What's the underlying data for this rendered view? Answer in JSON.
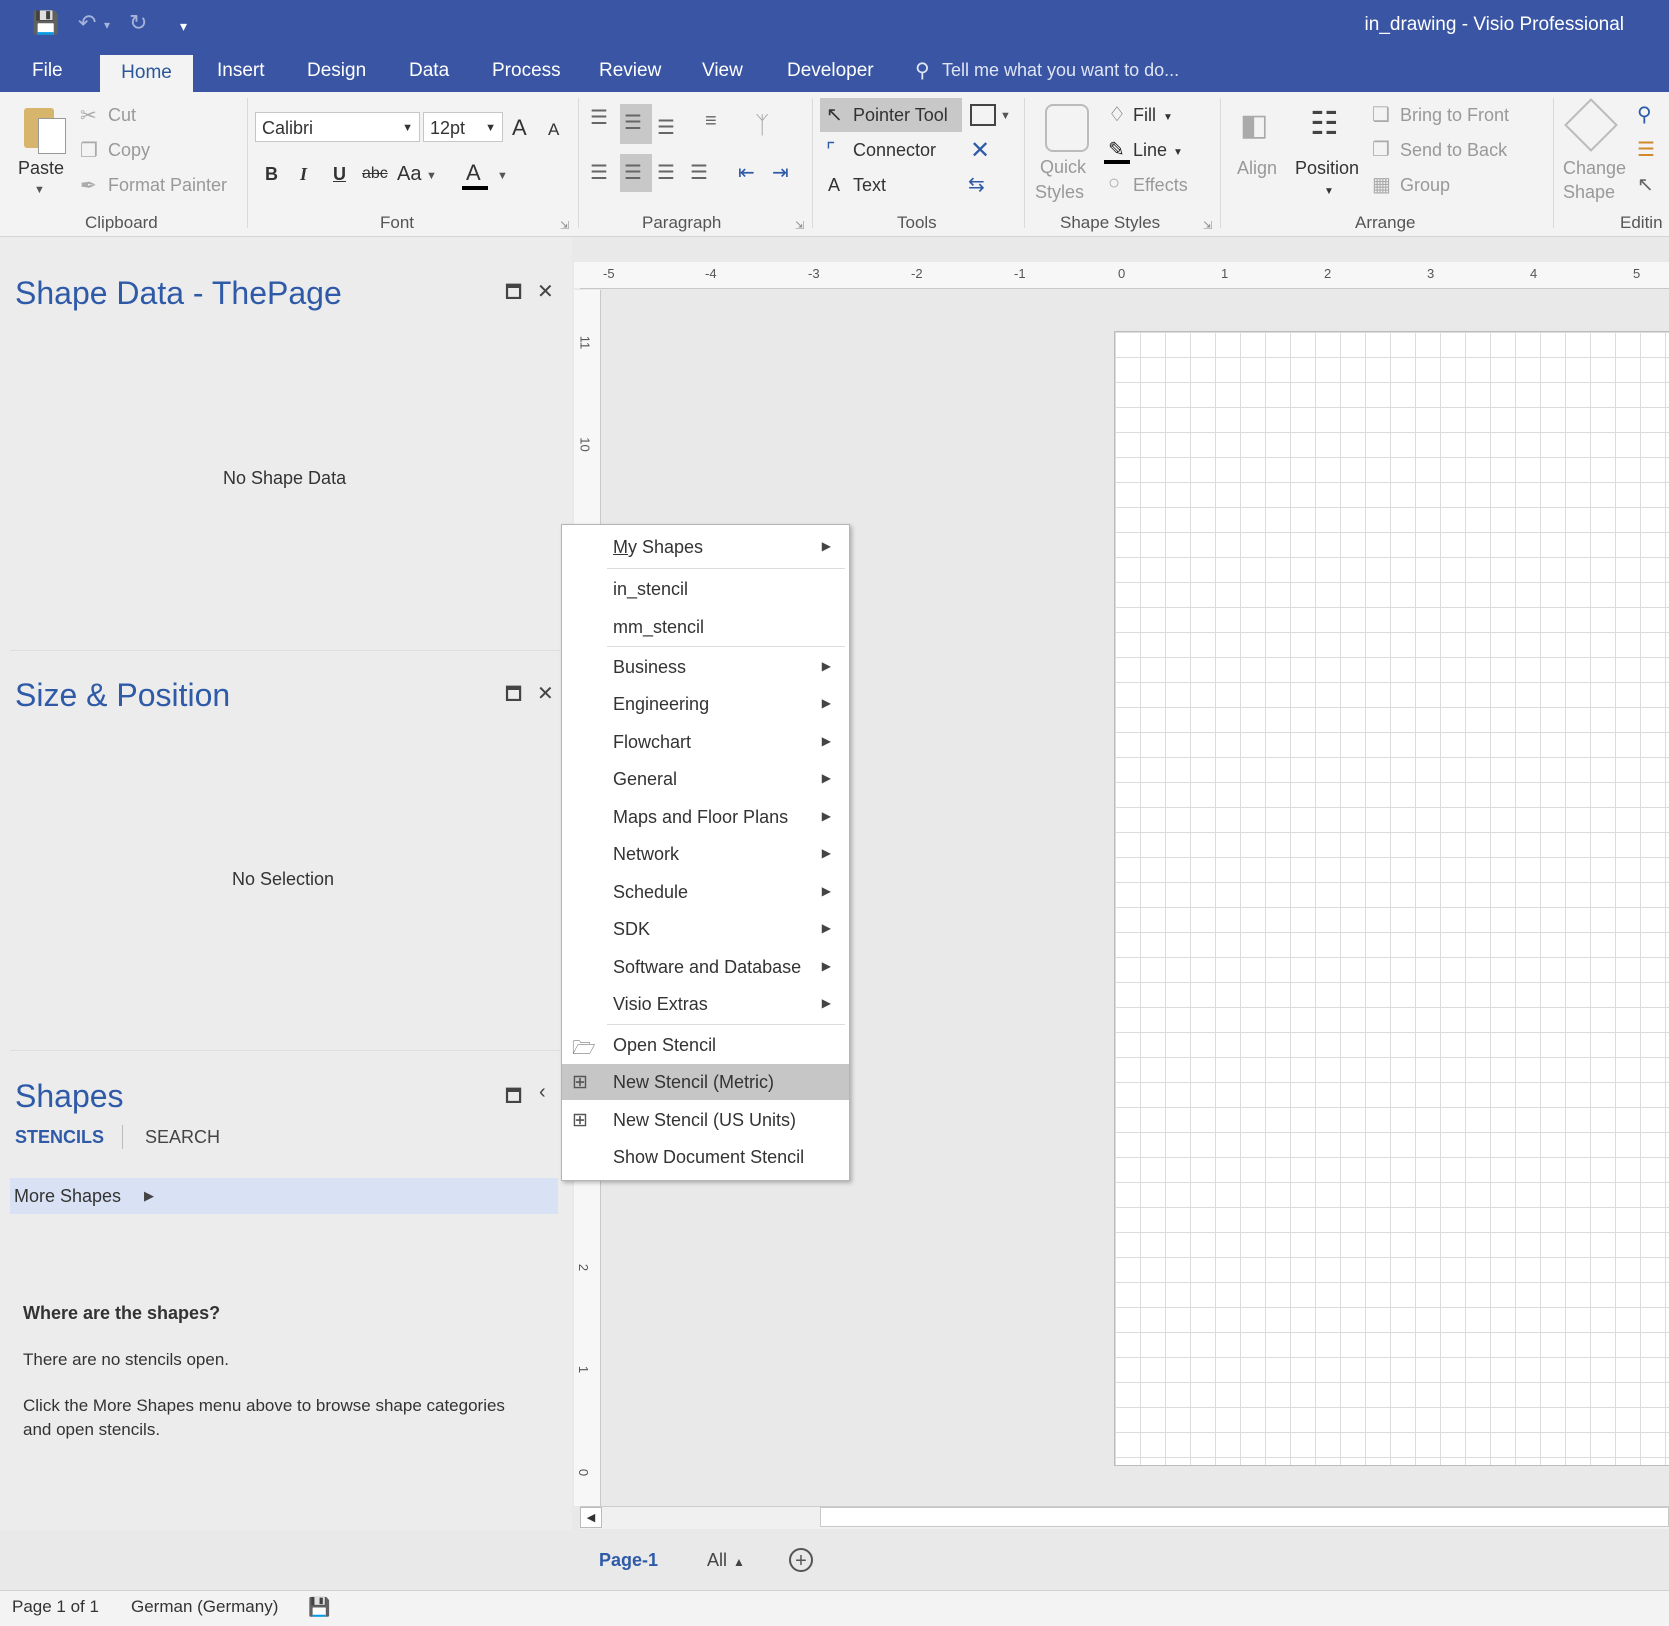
{
  "app": {
    "title": "in_drawing - Visio Professional"
  },
  "tabs": {
    "file": "File",
    "home": "Home",
    "insert": "Insert",
    "design": "Design",
    "data": "Data",
    "process": "Process",
    "review": "Review",
    "view": "View",
    "developer": "Developer"
  },
  "tellme": "Tell me what you want to do...",
  "clipboard": {
    "paste": "Paste",
    "cut": "Cut",
    "copy": "Copy",
    "format_painter": "Format Painter",
    "label": "Clipboard"
  },
  "font": {
    "name": "Calibri",
    "size": "12pt",
    "bold": "B",
    "italic": "I",
    "underline": "U",
    "strike": "abc",
    "case": "Aa",
    "grow": "A",
    "shrink": "A",
    "color": "A",
    "label": "Font"
  },
  "paragraph": {
    "label": "Paragraph"
  },
  "tools": {
    "pointer": "Pointer Tool",
    "connector": "Connector",
    "text": "Text",
    "text_glyph": "A",
    "label": "Tools"
  },
  "shape_styles": {
    "quick": "Quick",
    "styles": "Styles",
    "fill": "Fill",
    "line": "Line",
    "effects": "Effects",
    "label": "Shape Styles"
  },
  "arrange": {
    "align": "Align",
    "position": "Position",
    "bring_front": "Bring to Front",
    "send_back": "Send to Back",
    "group": "Group",
    "label": "Arrange"
  },
  "editing": {
    "change": "Change",
    "shape": "Shape",
    "label": "Editin"
  },
  "panes": {
    "shape_data": {
      "title": "Shape Data - ThePage",
      "empty": "No Shape Data"
    },
    "size_position": {
      "title": "Size & Position",
      "empty": "No Selection"
    },
    "shapes": {
      "title": "Shapes",
      "stencils": "STENCILS",
      "search": "SEARCH",
      "more_shapes": "More Shapes",
      "help_title": "Where are the shapes?",
      "help_line1": "There are no stencils open.",
      "help_line2a": "Click the More Shapes menu above to browse shape categories",
      "help_line2b": "and open stencils."
    }
  },
  "ruler": {
    "h": [
      "-5",
      "-4",
      "-3",
      "-2",
      "-1",
      "0",
      "1",
      "2",
      "3",
      "4",
      "5"
    ],
    "v": [
      "11",
      "10",
      "2",
      "1",
      "0"
    ]
  },
  "menu": {
    "my_shapes_u": "M",
    "my_shapes_rest": "y Shapes",
    "in_stencil": "in_stencil",
    "mm_stencil": "mm_stencil",
    "business": "Business",
    "engineering": "Engineering",
    "flowchart": "Flowchart",
    "general": "General",
    "maps": "Maps and Floor Plans",
    "network": "Network",
    "schedule": "Schedule",
    "sdk": "SDK",
    "software": "Software and Database",
    "visio_extras": "Visio Extras",
    "open_stencil": "Open Stencil",
    "new_metric": "New Stencil (Metric)",
    "new_us": "New Stencil (US Units)",
    "show_doc": "Show Document Stencil"
  },
  "pagetabs": {
    "page1": "Page-1",
    "all": "All"
  },
  "status": {
    "page": "Page 1 of 1",
    "language": "German (Germany)"
  },
  "colors": {
    "accent": "#3955a3",
    "pane_title": "#2e5aa8",
    "highlight": "#c6c6c6"
  }
}
